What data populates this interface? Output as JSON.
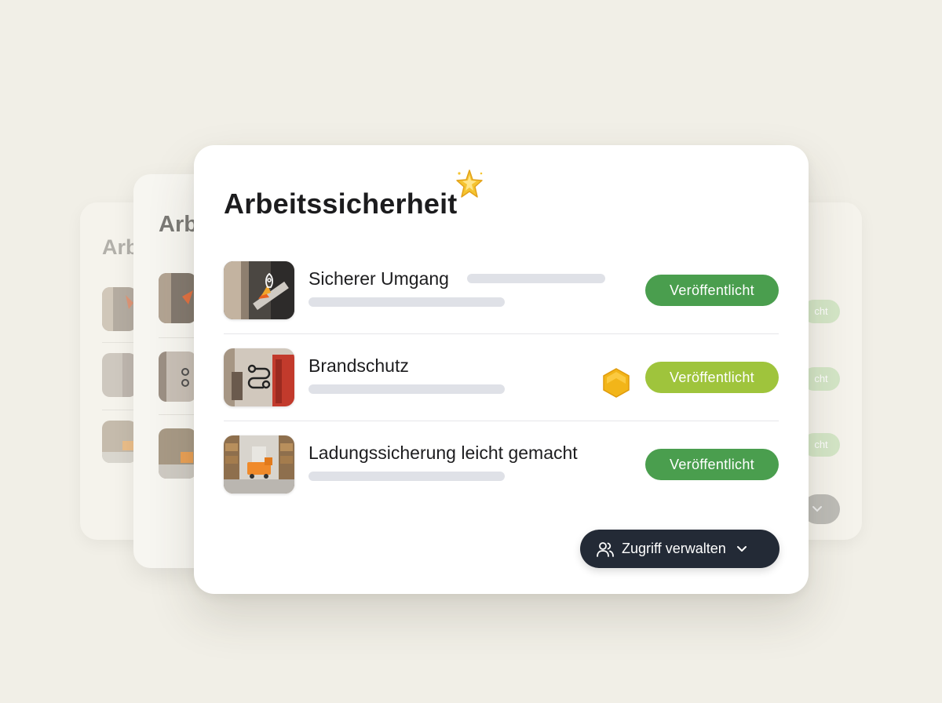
{
  "background_card_title": "Arb",
  "main_card": {
    "title": "Arbeitssicherheit",
    "rows": [
      {
        "title": "Sicherer Umgang",
        "status": "Veröffentlicht",
        "thumb_icon": "rocket-icon"
      },
      {
        "title": "Brandschutz",
        "status": "Veröffentlicht",
        "thumb_icon": "workflow-icon"
      },
      {
        "title": "Ladungssicherung leicht gemacht",
        "status": "Veröffentlicht",
        "thumb_icon": "truck-icon"
      }
    ],
    "access_button": {
      "label": "Zugriff verwalten",
      "icon": "users-icon"
    }
  },
  "ghost_status_fragments": [
    "cht",
    "cht",
    "cht"
  ],
  "colors": {
    "background": "#f1efe7",
    "published_green": "#4a9e4e",
    "published_lime": "#9fc43c",
    "dark_button": "#232a36",
    "badge_gold": "#f2b519"
  }
}
